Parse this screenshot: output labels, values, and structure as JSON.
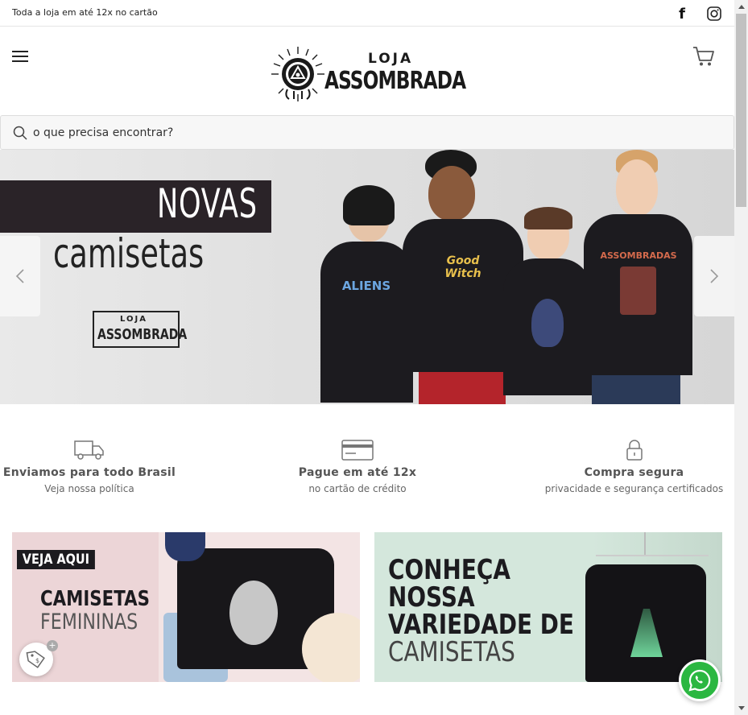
{
  "topbar": {
    "installments_text": "Toda a loja em até 12x no cartão",
    "facebook_icon": "facebook-icon",
    "instagram_icon": "instagram-icon"
  },
  "header": {
    "logo_top": "LOJA",
    "logo_bottom": "ASSOMBRADA",
    "menu_icon": "hamburger-icon",
    "cart_icon": "cart-icon"
  },
  "search": {
    "placeholder": "o que precisa encontrar?",
    "value": ""
  },
  "hero": {
    "line1": "NOVAS",
    "line2": "camisetas",
    "badge_top": "LOJA",
    "badge_bottom": "ASSOMBRADA",
    "shirt_prints": [
      "ALIENS",
      "Good Witch",
      "",
      "ASSOMBRADAS"
    ]
  },
  "features": [
    {
      "icon": "truck-icon",
      "title": "Enviamos para todo Brasil",
      "subtitle": "Veja nossa política"
    },
    {
      "icon": "credit-card-icon",
      "title": "Pague em até 12x",
      "subtitle": "no cartão de crédito"
    },
    {
      "icon": "lock-icon",
      "title": "Compra segura",
      "subtitle": "privacidade e segurança certificados"
    }
  ],
  "banners": {
    "left": {
      "tag": "VEJA AQUI",
      "line1": "CAMISETAS",
      "line2": "FEMININAS"
    },
    "right": {
      "line1": "CONHEÇA",
      "line2": "NOSSA",
      "line3": "VARIEDADE DE",
      "line4": "CAMISETAS"
    }
  },
  "floating": {
    "coupon_icon": "coupon-tag-icon",
    "coupon_plus": "+",
    "whatsapp_icon": "whatsapp-icon"
  },
  "colors": {
    "brand_dark": "#1c1b1f",
    "whatsapp_green": "#2bb741",
    "banner_pink": "#ecd5d7",
    "banner_mint": "#d4e7dc"
  }
}
